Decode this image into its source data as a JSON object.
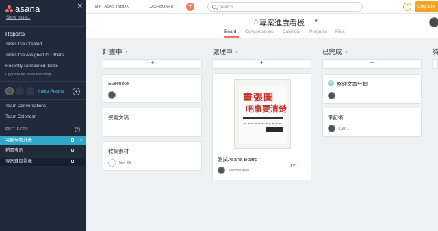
{
  "sidebar": {
    "logo": "asana",
    "show_more": "Show more...",
    "reports_title": "Reports",
    "report_links": [
      "Tasks I've Created",
      "Tasks I've Assigned to Others",
      "Recently Completed Tasks"
    ],
    "upgrade_link": "Upgrade for more reporting",
    "invite": "Invite People",
    "team_links": [
      "Team Conversations",
      "Team Calendar"
    ],
    "projects_title": "PROJECTS",
    "projects": [
      "電腦玩物計畫",
      "新書專案",
      "專案進度看板"
    ]
  },
  "topbar": {
    "nav": [
      "MY TASKS",
      "INBOX",
      "DASHBOARD"
    ],
    "search_placeholder": "Search",
    "help": "?",
    "upgrade": "Upgrade"
  },
  "project": {
    "title": "專案進度看板",
    "tabs": [
      "Board",
      "Conversations",
      "Calendar",
      "Progress",
      "Files"
    ],
    "active_tab": "Board"
  },
  "board": {
    "columns": [
      {
        "title": "計畫中",
        "cards": [
          {
            "title": "Evernote",
            "date": ""
          },
          {
            "title": "撰寫文稿",
            "date": ""
          },
          {
            "title": "收集素材",
            "date": "Nov 29"
          }
        ]
      },
      {
        "title": "處理中",
        "cards": [
          {
            "title": "測試Asana Board",
            "date": "Wednesday",
            "likes": "1"
          }
        ]
      },
      {
        "title": "已完成",
        "cards": [
          {
            "title": "整理文章分類",
            "date": ""
          },
          {
            "title": "筆記術",
            "date": "Dec 1"
          }
        ]
      },
      {
        "title": "待"
      }
    ],
    "book_cover_text": [
      "畫張圖",
      "吧事要清楚"
    ]
  },
  "colors": {
    "sidebar_bg": "#1f2a3a",
    "active_project": "#2fa8c8",
    "accent": "#f06a6a",
    "plus_blue": "#1f8dd6",
    "upgrade": "#f3a521"
  }
}
